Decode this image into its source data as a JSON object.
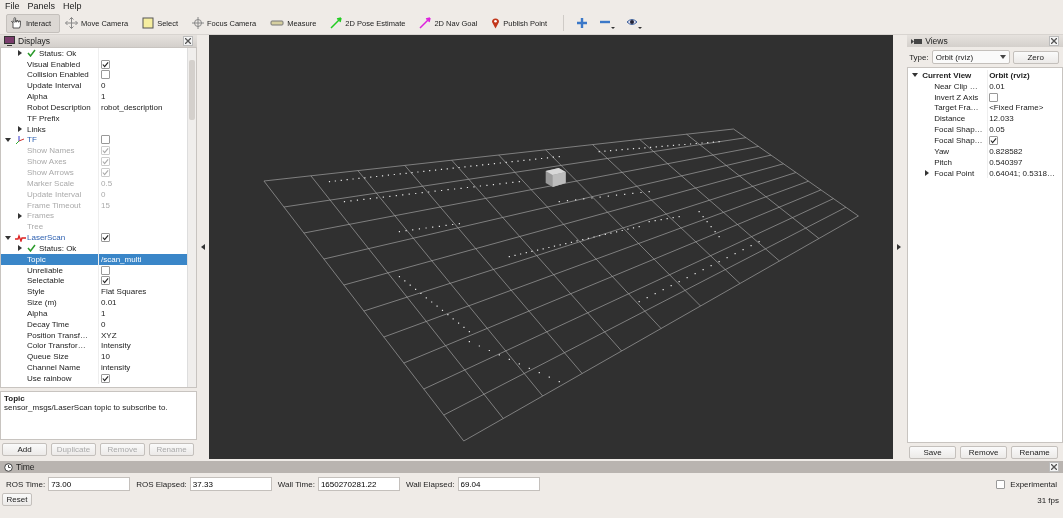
{
  "menu": [
    "File",
    "Panels",
    "Help"
  ],
  "toolbar": {
    "tools": [
      {
        "label": "Interact",
        "selected": true
      },
      {
        "label": "Move Camera",
        "selected": false
      },
      {
        "label": "Select",
        "selected": false
      },
      {
        "label": "Focus Camera",
        "selected": false
      },
      {
        "label": "Measure",
        "selected": false
      },
      {
        "label": "2D Pose Estimate",
        "selected": false
      },
      {
        "label": "2D Nav Goal",
        "selected": false
      },
      {
        "label": "Publish Point",
        "selected": false
      }
    ]
  },
  "displays": {
    "title": "Displays",
    "tree": [
      {
        "children": [
          {
            "kind": "status",
            "label": "Status: Ok",
            "expanded": false,
            "selected": false
          },
          {
            "label": "Visual Enabled",
            "checked": true,
            "selected": false
          },
          {
            "label": "Collision Enabled",
            "checked": false,
            "selected": false
          },
          {
            "label": "Update Interval",
            "value": "0",
            "selected": false
          },
          {
            "label": "Alpha",
            "value": "1",
            "selected": false
          },
          {
            "label": "Robot Description",
            "value": "robot_description",
            "selected": false
          },
          {
            "label": "TF Prefix",
            "selected": false
          },
          {
            "label": "Links",
            "expanded": false,
            "selected": false
          }
        ]
      },
      {
        "kind": "tf",
        "label": "TF",
        "checked": false,
        "expanded": true,
        "selected": false,
        "children": [
          {
            "label": "Show Names",
            "checked": true,
            "disabled": true,
            "selected": false
          },
          {
            "label": "Show Axes",
            "checked": true,
            "disabled": true,
            "selected": false
          },
          {
            "label": "Show Arrows",
            "checked": true,
            "disabled": true,
            "selected": false
          },
          {
            "label": "Marker Scale",
            "value": "0.5",
            "disabled": true,
            "selected": false
          },
          {
            "label": "Update Interval",
            "value": "0",
            "disabled": true,
            "selected": false
          },
          {
            "label": "Frame Timeout",
            "value": "15",
            "disabled": true,
            "selected": false
          },
          {
            "label": "Frames",
            "expanded": false,
            "disabled": true,
            "selected": false
          },
          {
            "label": "Tree",
            "disabled": true,
            "selected": false
          }
        ]
      },
      {
        "kind": "laser",
        "label": "LaserScan",
        "checked": true,
        "expanded": true,
        "selected": false,
        "children": [
          {
            "kind": "status",
            "label": "Status: Ok",
            "expanded": false,
            "selected": false
          },
          {
            "label": "Topic",
            "value": "/scan_multi",
            "selected": true
          },
          {
            "label": "Unreliable",
            "checked": false,
            "selected": false
          },
          {
            "label": "Selectable",
            "checked": true,
            "selected": false
          },
          {
            "label": "Style",
            "value": "Flat Squares",
            "selected": false
          },
          {
            "label": "Size (m)",
            "value": "0.01",
            "selected": false
          },
          {
            "label": "Alpha",
            "value": "1",
            "selected": false
          },
          {
            "label": "Decay Time",
            "value": "0",
            "selected": false
          },
          {
            "label": "Position Transf…",
            "value": "XYZ",
            "selected": false
          },
          {
            "label": "Color Transfor…",
            "value": "Intensity",
            "selected": false
          },
          {
            "label": "Queue Size",
            "value": "10",
            "selected": false
          },
          {
            "label": "Channel Name",
            "value": "intensity",
            "selected": false
          },
          {
            "label": "Use rainbow",
            "checked": true,
            "selected": false
          }
        ]
      }
    ],
    "description": {
      "title": "Topic",
      "text": "sensor_msgs/LaserScan topic to subscribe to."
    },
    "buttons": [
      {
        "label": "Add",
        "disabled": false
      },
      {
        "label": "Duplicate",
        "disabled": true
      },
      {
        "label": "Remove",
        "disabled": true
      },
      {
        "label": "Rename",
        "disabled": true
      }
    ]
  },
  "views": {
    "title": "Views",
    "type_label": "Type:",
    "type_value": "Orbit (rviz)",
    "zero_button": "Zero",
    "tree": [
      {
        "label": "Current View",
        "value": "Orbit (rviz)",
        "expanded": true,
        "selected": false,
        "children": [
          {
            "label": "Near Clip …",
            "value": "0.01",
            "selected": false
          },
          {
            "label": "Invert Z Axis",
            "checked": false,
            "selected": false
          },
          {
            "label": "Target Fra…",
            "value": "<Fixed Frame>",
            "selected": false
          },
          {
            "label": "Distance",
            "value": "12.033",
            "selected": false
          },
          {
            "label": "Focal Shap…",
            "value": "0.05",
            "selected": false
          },
          {
            "label": "Focal Shap…",
            "checked": true,
            "selected": false
          },
          {
            "label": "Yaw",
            "value": "0.828582",
            "selected": false
          },
          {
            "label": "Pitch",
            "value": "0.540397",
            "selected": false
          },
          {
            "label": "Focal Point",
            "value": "0.64041; 0.5318…",
            "expanded": false,
            "selected": false
          }
        ]
      }
    ],
    "buttons": [
      "Save",
      "Remove",
      "Rename"
    ]
  },
  "time": {
    "title": "Time",
    "fields": [
      {
        "label": "ROS Time:",
        "value": "73.00"
      },
      {
        "label": "ROS Elapsed:",
        "value": "37.33"
      },
      {
        "label": "Wall Time:",
        "value": "1650270281.22"
      },
      {
        "label": "Wall Elapsed:",
        "value": "69.04"
      }
    ],
    "experimental": {
      "label": "Experimental",
      "checked": false
    },
    "reset_button": "Reset",
    "fps": "31 fps"
  }
}
